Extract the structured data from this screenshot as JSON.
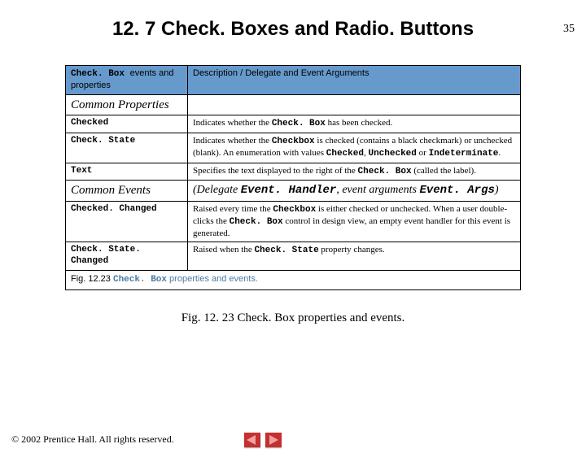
{
  "page_number": "35",
  "title": "12. 7   Check. Boxes and Radio. Buttons",
  "header": {
    "col1_bold": "Check. Box ",
    "col1_rest": "events and properties",
    "col2": "Description / Delegate and Event Arguments"
  },
  "sections": [
    {
      "label": "Common Properties",
      "right": ""
    }
  ],
  "rows": [
    {
      "prop": "Checked",
      "desc_pre": "Indicates whether the ",
      "m1": "Check. Box",
      "desc_post": " has been checked."
    },
    {
      "prop": "Check. State",
      "desc_pre": "Indicates whether the ",
      "m1": "Checkbox",
      "desc_mid": " is checked (contains a black checkmark) or unchecked (blank). An enumeration with values ",
      "m2": "Checked",
      "sep1": ", ",
      "m3": "Unchecked",
      "sep2": " or ",
      "m4": "Indeterminate",
      "tail": "."
    },
    {
      "prop": "Text",
      "desc_pre": "Specifies the text displayed to the right of the ",
      "m1": "Check. Box",
      "desc_post": " (called the label)."
    }
  ],
  "events_section": {
    "label": "Common Events",
    "right_pre": "(Delegate ",
    "right_m1": "Event. Handler",
    "right_mid": ", event arguments ",
    "right_m2": "Event. Args",
    "right_post": ")"
  },
  "event_rows": [
    {
      "prop": "Checked. Changed",
      "desc_pre": "Raised every time the ",
      "m1": "Checkbox",
      "desc_mid": " is either checked or unchecked. When a user double-clicks the ",
      "m2": "Check. Box",
      "desc_post": " control in design view, an empty event handler for this event is generated."
    },
    {
      "prop": "Check. State. Changed",
      "desc_pre": "Raised when the ",
      "m1": "Check. State",
      "desc_post": " property changes."
    }
  ],
  "table_caption": {
    "num": "Fig. 12.23",
    "rest_pre": " ",
    "rest_bold": "Check. Box",
    "rest_post": " properties and events."
  },
  "fig_caption": "Fig. 12. 23 Check. Box properties and events.",
  "footer": "© 2002 Prentice Hall. All rights reserved."
}
